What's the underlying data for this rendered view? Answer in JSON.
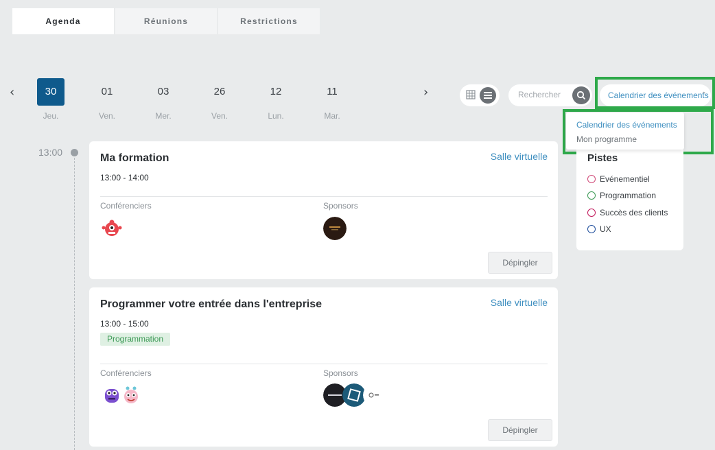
{
  "tabs": [
    {
      "label": "Agenda",
      "active": true
    },
    {
      "label": "Réunions",
      "active": false
    },
    {
      "label": "Restrictions",
      "active": false
    }
  ],
  "dates": [
    {
      "day": "30",
      "weekday": "Jeu.",
      "active": true
    },
    {
      "day": "01",
      "weekday": "Ven."
    },
    {
      "day": "03",
      "weekday": "Mer."
    },
    {
      "day": "26",
      "weekday": "Ven."
    },
    {
      "day": "12",
      "weekday": "Lun."
    },
    {
      "day": "11",
      "weekday": "Mar."
    }
  ],
  "nav": {
    "prev": "‹",
    "next": "›"
  },
  "search": {
    "placeholder": "Rechercher"
  },
  "calendar_select": {
    "value": "Calendrier des événements",
    "options": [
      "Calendrier des événements",
      "Mon programme"
    ]
  },
  "tracks": {
    "title": "Pistes",
    "items": [
      {
        "label": "Evénementiel",
        "color": "#d04a78"
      },
      {
        "label": "Programmation",
        "color": "#3c9a55"
      },
      {
        "label": "Succès des clients",
        "color": "#c2185b"
      },
      {
        "label": "UX",
        "color": "#1f4e9c"
      }
    ]
  },
  "timeline": {
    "time": "13:00"
  },
  "sessions": [
    {
      "title": "Ma formation",
      "room": "Salle virtuelle",
      "time": "13:00 - 14:00",
      "speakers_label": "Conférenciers",
      "sponsors_label": "Sponsors",
      "unpin": "Dépingler"
    },
    {
      "title": "Programmer votre entrée dans l'entreprise",
      "room": "Salle virtuelle",
      "time": "13:00 - 15:00",
      "track": "Programmation",
      "speakers_label": "Conférenciers",
      "sponsors_label": "Sponsors",
      "unpin": "Dépingler"
    }
  ],
  "colors": {
    "accent": "#0f5a8c",
    "link": "#3f8fc0",
    "highlight": "#2ea94a"
  }
}
